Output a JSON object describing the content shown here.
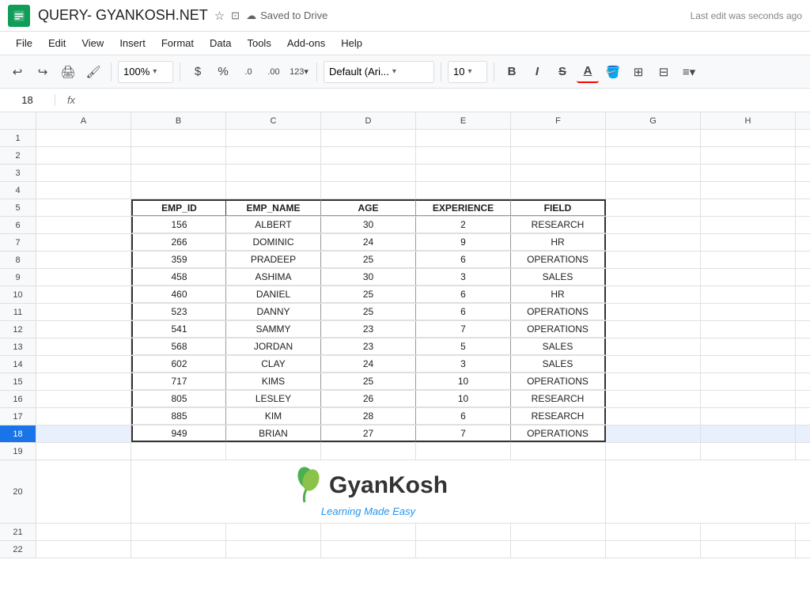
{
  "titlebar": {
    "title": "QUERY- GYANKOSH.NET",
    "saved_status": "Saved to Drive",
    "last_edit": "Last edit was seconds ago"
  },
  "menubar": {
    "items": [
      "File",
      "Edit",
      "View",
      "Insert",
      "Format",
      "Data",
      "Tools",
      "Add-ons",
      "Help"
    ]
  },
  "toolbar": {
    "zoom": "100%",
    "font": "Default (Ari...",
    "size": "10",
    "currency_symbol": "$",
    "percent_symbol": "%"
  },
  "formulabar": {
    "cell_ref": "18",
    "fx_label": "fx"
  },
  "columns": {
    "letters": [
      "A",
      "B",
      "C",
      "D",
      "E",
      "F",
      "G",
      "H"
    ],
    "widths": [
      120,
      120,
      120,
      120,
      120,
      120,
      120,
      120
    ]
  },
  "rows": {
    "count": 22,
    "data_start_row": 5,
    "selected_row": 18,
    "headers": [
      "EMP_ID",
      "EMP_NAME",
      "AGE",
      "EXPERIENCE",
      "FIELD"
    ],
    "records": [
      {
        "emp_id": "156",
        "emp_name": "ALBERT",
        "age": "30",
        "experience": "2",
        "field": "RESEARCH"
      },
      {
        "emp_id": "266",
        "emp_name": "DOMINIC",
        "age": "24",
        "experience": "9",
        "field": "HR"
      },
      {
        "emp_id": "359",
        "emp_name": "PRADEEP",
        "age": "25",
        "experience": "6",
        "field": "OPERATIONS"
      },
      {
        "emp_id": "458",
        "emp_name": "ASHIMA",
        "age": "30",
        "experience": "3",
        "field": "SALES"
      },
      {
        "emp_id": "460",
        "emp_name": "DANIEL",
        "age": "25",
        "experience": "6",
        "field": "HR"
      },
      {
        "emp_id": "523",
        "emp_name": "DANNY",
        "age": "25",
        "experience": "6",
        "field": "OPERATIONS"
      },
      {
        "emp_id": "541",
        "emp_name": "SAMMY",
        "age": "23",
        "experience": "7",
        "field": "OPERATIONS"
      },
      {
        "emp_id": "568",
        "emp_name": "JORDAN",
        "age": "23",
        "experience": "5",
        "field": "SALES"
      },
      {
        "emp_id": "602",
        "emp_name": "CLAY",
        "age": "24",
        "experience": "3",
        "field": "SALES"
      },
      {
        "emp_id": "717",
        "emp_name": "KIMS",
        "age": "25",
        "experience": "10",
        "field": "OPERATIONS"
      },
      {
        "emp_id": "805",
        "emp_name": "LESLEY",
        "age": "26",
        "experience": "10",
        "field": "RESEARCH"
      },
      {
        "emp_id": "885",
        "emp_name": "KIM",
        "age": "28",
        "experience": "6",
        "field": "RESEARCH"
      },
      {
        "emp_id": "949",
        "emp_name": "BRIAN",
        "age": "27",
        "experience": "7",
        "field": "OPERATIONS"
      }
    ]
  },
  "logo": {
    "name": "GyanKosh",
    "subtitle": "Learning Made Easy"
  }
}
